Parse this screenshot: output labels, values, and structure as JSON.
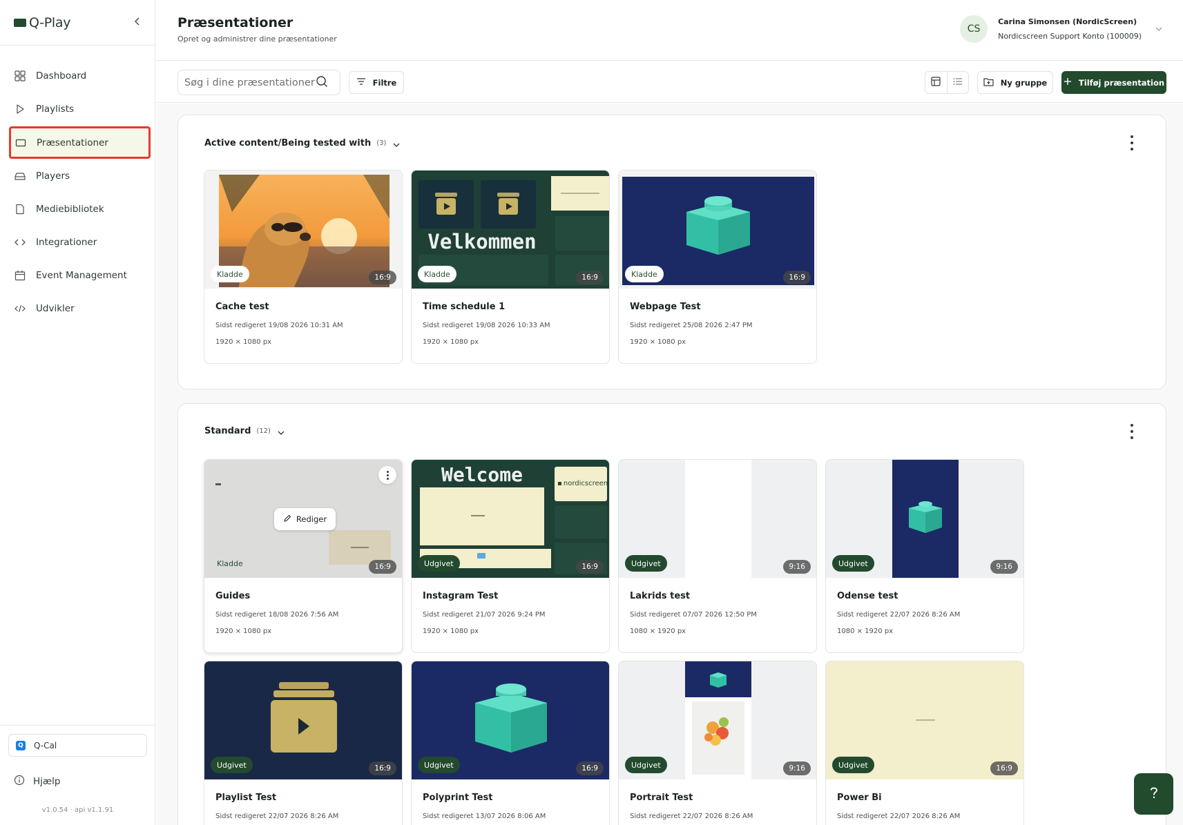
{
  "app": {
    "name": "Q-Play"
  },
  "sidebar": {
    "collapse_icon": "chevron-left-icon",
    "items": [
      {
        "label": "Dashboard",
        "icon": "dashboard-icon"
      },
      {
        "label": "Playlists",
        "icon": "play-icon"
      },
      {
        "label": "Præsentationer",
        "icon": "presentation-icon",
        "active": true
      },
      {
        "label": "Players",
        "icon": "player-icon"
      },
      {
        "label": "Mediebibliotek",
        "icon": "file-icon"
      },
      {
        "label": "Integrationer",
        "icon": "code-brackets-icon"
      },
      {
        "label": "Event Management",
        "icon": "calendar-icon"
      },
      {
        "label": "Udvikler",
        "icon": "code-slash-icon"
      }
    ],
    "qcal": {
      "label": "Q-Cal"
    },
    "help": {
      "label": "Hjælp"
    },
    "version": "v1.0.54 · api v1.1.91"
  },
  "header": {
    "title": "Præsentationer",
    "subtitle": "Opret og administrer dine præsentationer",
    "user": {
      "initials": "CS",
      "name": "Carina Simonsen (NordicScreen)",
      "account": "Nordicscreen Support Konto (100009)"
    }
  },
  "toolbar": {
    "search_placeholder": "Søg i dine præsentationer",
    "filter_label": "Filtre",
    "new_group_label": "Ny gruppe",
    "add_label": "Tilføj præsentation"
  },
  "groups": [
    {
      "title": "Active content/Being tested with",
      "count": "(3)",
      "cards": [
        {
          "title": "Cache test",
          "status": "Kladde",
          "ratio": "16:9",
          "edited": "Sidst redigeret 19/08 2026 10:31 AM",
          "size": "1920 × 1080 px"
        },
        {
          "title": "Time schedule 1",
          "status": "Kladde",
          "ratio": "16:9",
          "edited": "Sidst redigeret 19/08 2026 10:33 AM",
          "size": "1920 × 1080 px",
          "thumb_text": "Velkommen"
        },
        {
          "title": "Webpage Test",
          "status": "Kladde",
          "ratio": "16:9",
          "edited": "Sidst redigeret 25/08 2026 2:47 PM",
          "size": "1920 × 1080 px"
        }
      ]
    },
    {
      "title": "Standard",
      "count": "(12)",
      "cards": [
        {
          "title": "Guides",
          "status": "Kladde",
          "ratio": "16:9",
          "edited": "Sidst redigeret 18/08 2026 7:56 AM",
          "size": "1920 × 1080 px",
          "edit_label": "Rediger"
        },
        {
          "title": "Instagram Test",
          "status": "Udgivet",
          "ratio": "16:9",
          "edited": "Sidst redigeret 21/07 2026 9:24 PM",
          "size": "1920 × 1080 px",
          "thumb_text": "Welcome",
          "thumb_logo": "nordicscreen"
        },
        {
          "title": "Lakrids test",
          "status": "Udgivet",
          "ratio": "9:16",
          "edited": "Sidst redigeret 07/07 2026 12:50 PM",
          "size": "1080 × 1920 px"
        },
        {
          "title": "Odense test",
          "status": "Udgivet",
          "ratio": "9:16",
          "edited": "Sidst redigeret 22/07 2026 8:26 AM",
          "size": "1080 × 1920 px"
        },
        {
          "title": "Playlist Test",
          "status": "Udgivet",
          "ratio": "16:9",
          "edited": "Sidst redigeret 22/07 2026 8:26 AM",
          "size": ""
        },
        {
          "title": "Polyprint Test",
          "status": "Udgivet",
          "ratio": "16:9",
          "edited": "Sidst redigeret 13/07 2026 8:06 AM",
          "size": ""
        },
        {
          "title": "Portrait Test",
          "status": "Udgivet",
          "ratio": "9:16",
          "edited": "Sidst redigeret 22/07 2026 8:26 AM",
          "size": ""
        },
        {
          "title": "Power Bi",
          "status": "Udgivet",
          "ratio": "16:9",
          "edited": "Sidst redigeret 22/07 2026 8:26 AM",
          "size": ""
        }
      ]
    }
  ],
  "colors": {
    "brand": "#224a2d",
    "active_highlight": "#e53a2b",
    "active_bg": "#f5f7e8"
  }
}
